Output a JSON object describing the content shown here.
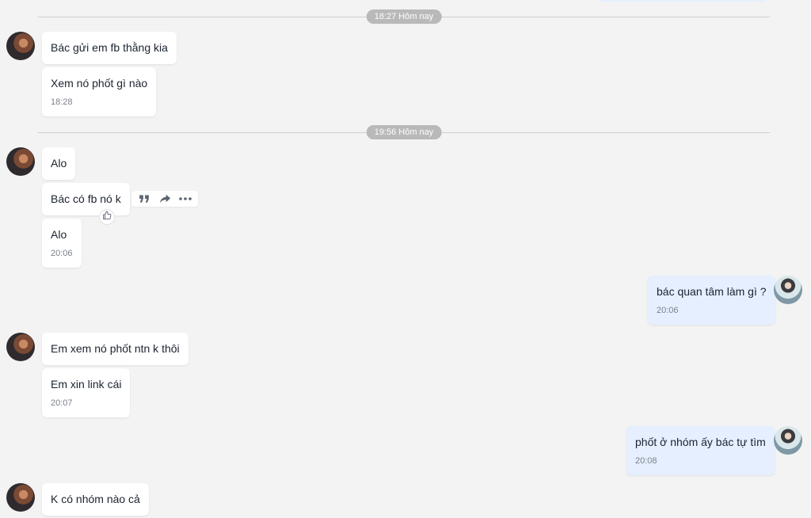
{
  "dividers": [
    {
      "label": "18:27 Hôm nay"
    },
    {
      "label": "19:56 Hôm nay"
    }
  ],
  "messages": [
    {
      "text": "Bác gửi em fb thằng kia",
      "time": ""
    },
    {
      "text": "Xem nó phốt gì nào",
      "time": "18:28"
    },
    {
      "text": "Alo",
      "time": ""
    },
    {
      "text": "Bác có fb nó k",
      "time": ""
    },
    {
      "text": "Alo",
      "time": "20:06"
    },
    {
      "text": "bác quan tâm làm gì ?",
      "time": "20:06"
    },
    {
      "text": "Em xem nó phốt ntn k thôi",
      "time": ""
    },
    {
      "text": "Em xin link cái",
      "time": "20:07"
    },
    {
      "text": "phốt ở nhóm ấy bác tự tìm",
      "time": "20:08"
    },
    {
      "text": "K có nhóm nào cả",
      "time": ""
    }
  ],
  "message_toolbar": {
    "icons": [
      "quote-icon",
      "forward-icon",
      "more-icon"
    ]
  },
  "colors": {
    "background": "#f3f3f3",
    "incoming_bubble": "#ffffff",
    "outgoing_bubble": "#e5efff",
    "divider_pill": "#b9b9b9",
    "timestamp": "#7b8189"
  }
}
